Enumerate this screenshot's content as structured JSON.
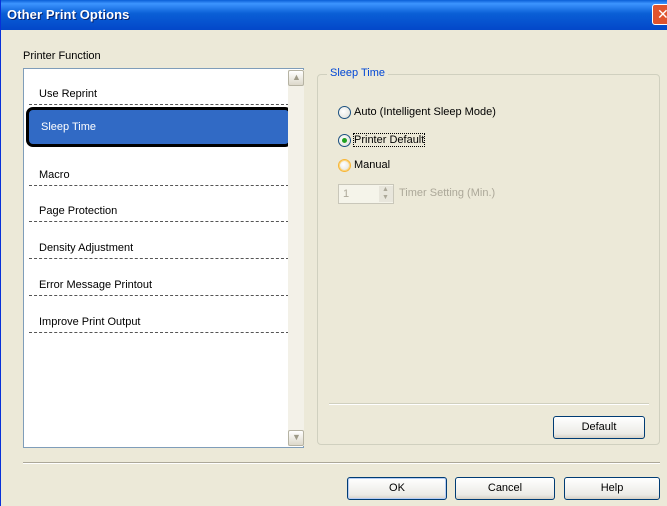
{
  "window": {
    "title": "Other Print Options"
  },
  "printer_function": {
    "label": "Printer Function",
    "items": [
      {
        "label": "Use Reprint",
        "selected": false
      },
      {
        "label": "Sleep Time",
        "selected": true
      },
      {
        "label": "Macro",
        "selected": false
      },
      {
        "label": "Page Protection",
        "selected": false
      },
      {
        "label": "Density Adjustment",
        "selected": false
      },
      {
        "label": "Error Message Printout",
        "selected": false
      },
      {
        "label": "Improve Print Output",
        "selected": false
      }
    ]
  },
  "sleep_time": {
    "legend": "Sleep Time",
    "options": {
      "auto": "Auto (Intelligent Sleep Mode)",
      "printer_default": "Printer Default",
      "manual": "Manual"
    },
    "selected": "printer_default",
    "timer_value": "1",
    "timer_label": "Timer Setting (Min.)",
    "default_button": "Default"
  },
  "buttons": {
    "ok": "OK",
    "cancel": "Cancel",
    "help": "Help"
  },
  "colors": {
    "titlebar": "#0a5fd6",
    "selection": "#316ac5",
    "legend": "#0046d5"
  }
}
